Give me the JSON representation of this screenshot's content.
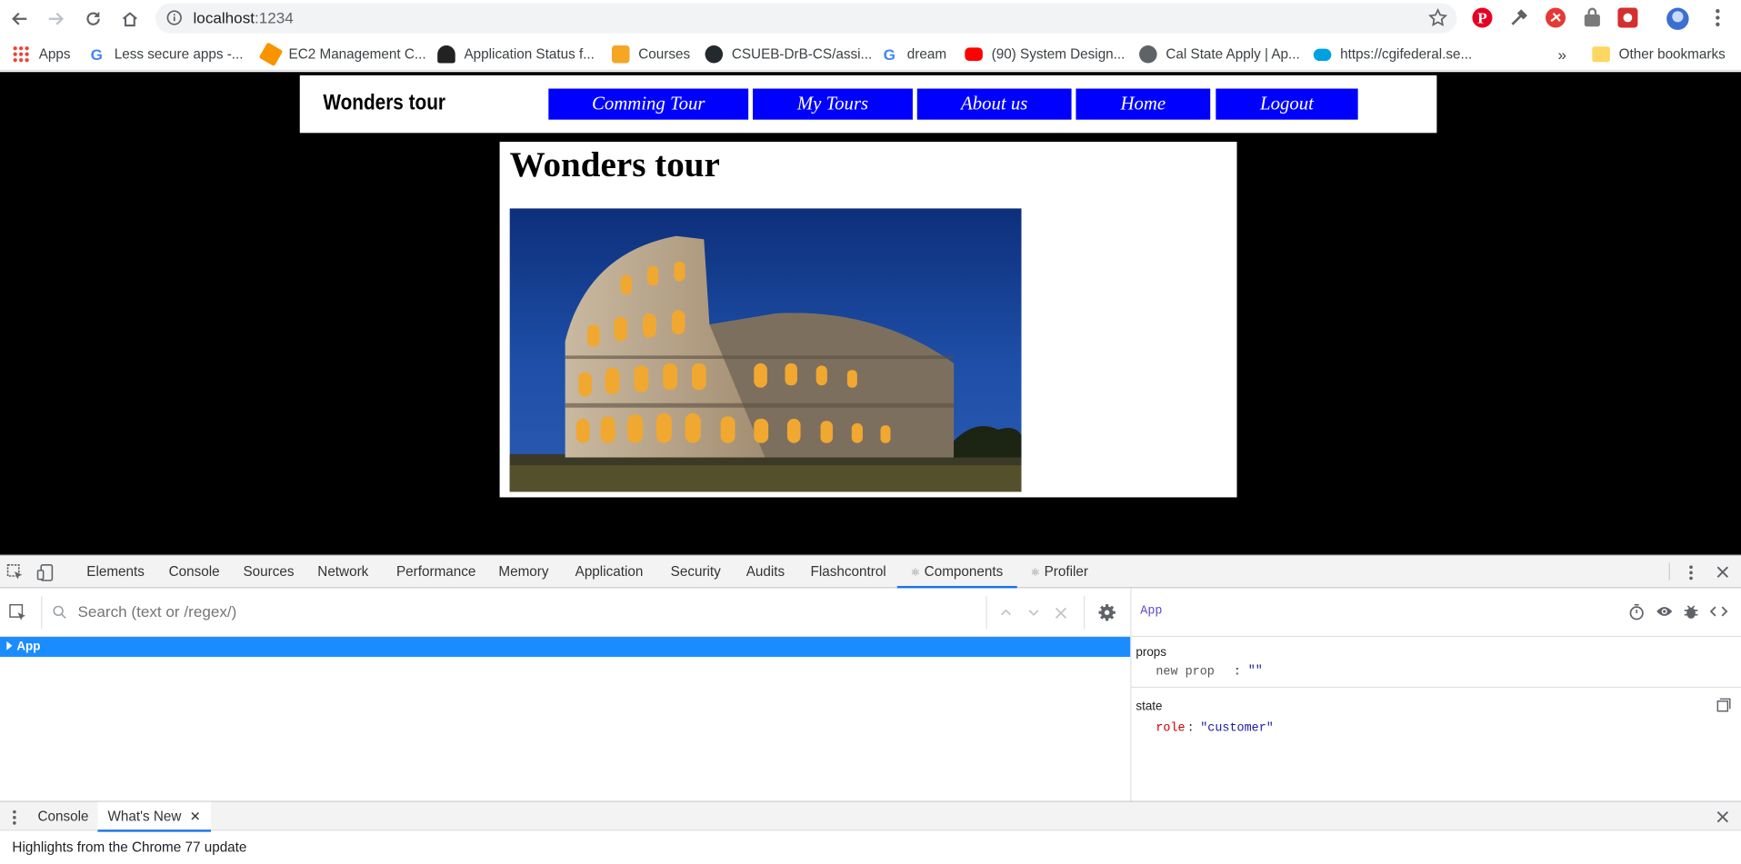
{
  "browser": {
    "url_host": "localhost",
    "url_port": ":1234",
    "bookmarks": [
      {
        "label": "Apps",
        "icon": "apps-grid-icon",
        "color": "#4285f4"
      },
      {
        "label": "Less secure apps -...",
        "icon": "google-icon",
        "color": "#ea4335"
      },
      {
        "label": "EC2 Management C...",
        "icon": "aws-cube-icon",
        "color": "#f79400"
      },
      {
        "label": "Application Status f...",
        "icon": "person-icon",
        "color": "#222222"
      },
      {
        "label": "Courses",
        "icon": "pencil-icon",
        "color": "#f5a623"
      },
      {
        "label": "CSUEB-DrB-CS/assi...",
        "icon": "github-icon",
        "color": "#24292e"
      },
      {
        "label": "dream",
        "icon": "google-icon",
        "color": "#4285f4"
      },
      {
        "label": "(90) System Design...",
        "icon": "youtube-icon",
        "color": "#ff0000"
      },
      {
        "label": "Cal State Apply | Ap...",
        "icon": "globe-icon",
        "color": "#5f6368"
      },
      {
        "label": "https://cgifederal.se...",
        "icon": "salesforce-cloud-icon",
        "color": "#00a1e0"
      }
    ],
    "overflow_label": "»",
    "other_bookmarks": "Other bookmarks"
  },
  "site": {
    "brand": "Wonders tour",
    "nav": [
      "Comming Tour",
      "My Tours",
      "About us",
      "Home",
      "Logout"
    ],
    "heading": "Wonders tour",
    "image_subject": "colosseum-photo"
  },
  "devtools": {
    "tabs": [
      "Elements",
      "Console",
      "Sources",
      "Network",
      "Performance",
      "Memory",
      "Application",
      "Security",
      "Audits",
      "Flashcontrol",
      "Components",
      "Profiler"
    ],
    "active_tab": "Components",
    "search_placeholder": "Search (text or /regex/)",
    "tree_root": "App",
    "selected_component": "App",
    "props_label": "props",
    "prop_key": "new prop",
    "prop_sep": ":",
    "prop_value": "\"\"",
    "state_label": "state",
    "state_key": "role",
    "state_sep": ":",
    "state_value": "\"customer\"",
    "drawer_tabs": [
      "Console",
      "What's New"
    ],
    "drawer_active": "What's New",
    "whats_new_text": "Highlights from the Chrome 77 update"
  },
  "colors": {
    "nav_button_bg": "#0000ff",
    "selection_blue": "#1a8cff",
    "accent_blue": "#1a73e8",
    "state_key_color": "#c80000"
  }
}
